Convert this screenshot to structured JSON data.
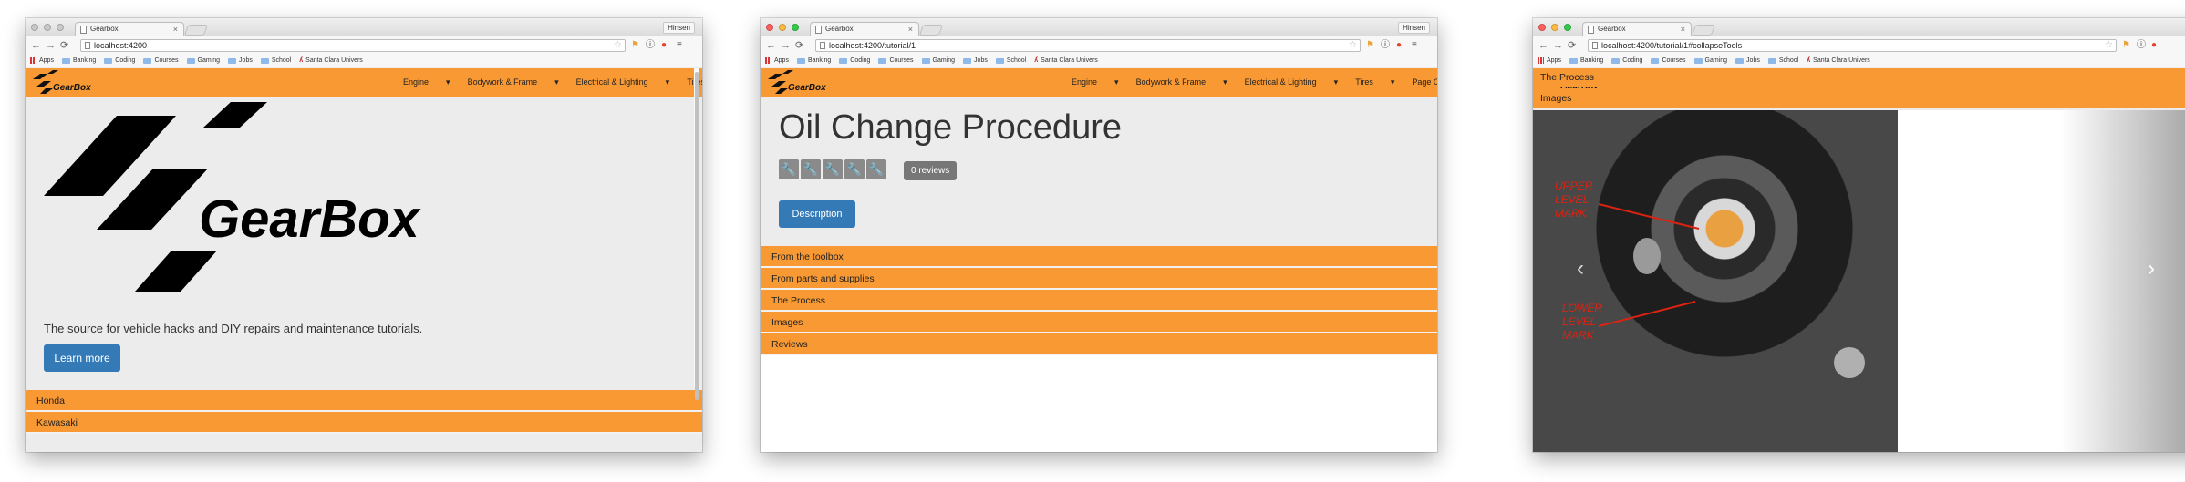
{
  "colors": {
    "navbar": "#f89933",
    "primary_button": "#337ab7",
    "page_bg": "#ececec",
    "badge": "#777777"
  },
  "tab_title": "Gearbox",
  "user_name": "Hinsen",
  "bookmarks": [
    "Apps",
    "Banking",
    "Coding",
    "Courses",
    "Gaming",
    "Jobs",
    "School",
    "Santa Clara Univers"
  ],
  "nav": {
    "brand": "GearBox",
    "menu": [
      "Engine",
      "Bodywork & Frame",
      "Electrical & Lighting",
      "Tires",
      "Page Options"
    ]
  },
  "windows": [
    {
      "url": "localhost:4200",
      "jumbotron": {
        "logo_text": "GearBox",
        "tagline": "The source for vehicle hacks and DIY repairs and maintenance tutorials.",
        "button": "Learn more"
      },
      "list": [
        "Honda",
        "Kawasaki"
      ]
    },
    {
      "url": "localhost:4200/tutorial/1",
      "title": "Oil Change Procedure",
      "rating": 0,
      "reviews_badge": "0 reviews",
      "description_button": "Description",
      "sections": [
        "From the toolbox",
        "From parts and supplies",
        "The Process",
        "Images",
        "Reviews"
      ]
    },
    {
      "url": "localhost:4200/tutorial/1#collapseTools",
      "sections": [
        "The Process",
        "Images"
      ],
      "photo_annotations": [
        "UPPER",
        "LEVEL",
        "MARK",
        "LOWER",
        "LEVEL",
        "MARK"
      ],
      "carousel": {
        "prev": "‹",
        "next": "›"
      }
    }
  ]
}
